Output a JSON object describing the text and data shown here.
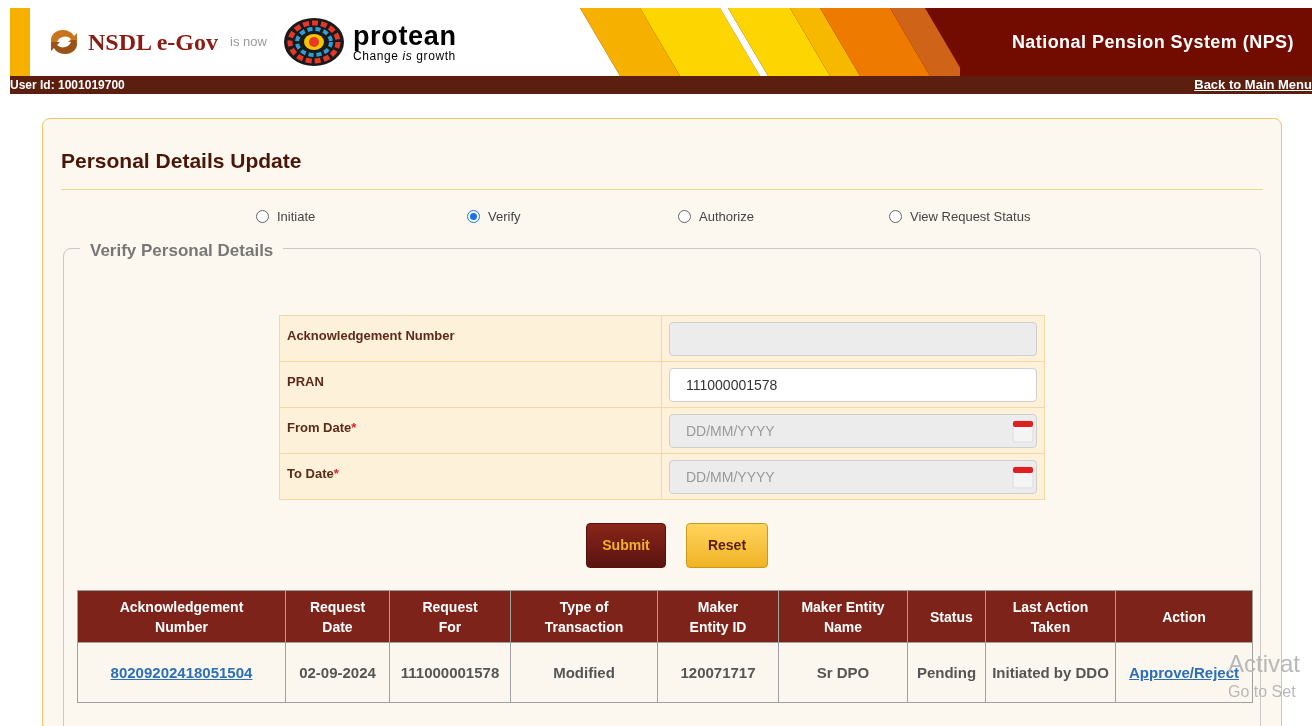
{
  "header": {
    "brand": "NSDL e-Gov",
    "connector": "is now",
    "new_brand": "protean",
    "tagline": "Change *is* growth",
    "system_title": "National Pension System (NPS)"
  },
  "user_bar": {
    "user_id": "User Id: 1001019700",
    "back_link": "Back to Main Menu"
  },
  "page": {
    "title": "Personal Details Update",
    "modes": [
      {
        "label": "Initiate",
        "selected": false
      },
      {
        "label": "Verify",
        "selected": true
      },
      {
        "label": "Authorize",
        "selected": false
      },
      {
        "label": "View Request Status",
        "selected": false
      }
    ],
    "fieldset_title": "Verify Personal Details",
    "form": [
      {
        "label": "Acknowledgement Number",
        "kind": "text",
        "disabled": true
      },
      {
        "label": "PRAN",
        "kind": "text",
        "value": "111000001578",
        "disabled": false
      },
      {
        "label": "From Date",
        "required_mark": "*",
        "kind": "date",
        "placeholder": "DD/MM/YYYY",
        "disabled": true
      },
      {
        "label": "To Date",
        "required_mark": "*",
        "kind": "date",
        "placeholder": "DD/MM/YYYY",
        "disabled": true
      }
    ],
    "buttons": [
      {
        "label": "Submit",
        "kind": "primary"
      },
      {
        "label": "Reset",
        "kind": "secondary"
      }
    ],
    "table": {
      "columns": [
        "Acknowledgement Number",
        "Request Date",
        "Request For",
        "Type of Transaction",
        "Maker Entity ID",
        "Maker Entity Name",
        "Status",
        "Last Action Taken",
        "Action"
      ],
      "rows": [
        {
          "cells": [
            {
              "text": "80209202418051504",
              "kind": "link"
            },
            {
              "text": "02-09-2024",
              "kind": "text"
            },
            {
              "text": "111000001578",
              "kind": "text"
            },
            {
              "text": "Modified",
              "kind": "text"
            },
            {
              "text": "120071717",
              "kind": "text"
            },
            {
              "text": "Sr DPO",
              "kind": "text"
            },
            {
              "text": "Pending",
              "kind": "text"
            },
            {
              "text": "Initiated by DDO",
              "kind": "text"
            },
            {
              "text": "Approve/Reject",
              "kind": "link"
            }
          ]
        }
      ]
    }
  },
  "os_overlay": [
    "Activat",
    "Go to Set"
  ]
}
